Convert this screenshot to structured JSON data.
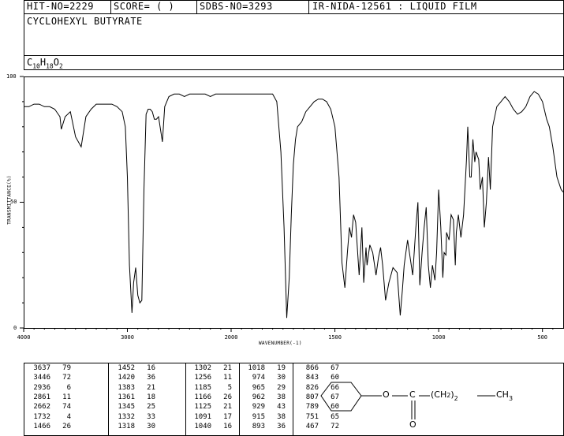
{
  "header": {
    "hit_no": "HIT-NO=2229",
    "score": "SCORE=  (  )",
    "sdbs_no": "SDBS-NO=3293",
    "ir_nida": "IR-NIDA-12561 : LIQUID FILM"
  },
  "compound_name": "CYCLOHEXYL BUTYRATE",
  "formula": {
    "c": "C",
    "c_n": "10",
    "h": "H",
    "h_n": "18",
    "o": "O",
    "o_n": "2"
  },
  "chart_data": {
    "type": "line",
    "xlabel": "WAVENUMBER(-1)",
    "ylabel": "TRANSMITTANCE(%)",
    "xlim": [
      4000,
      400
    ],
    "ylim": [
      0,
      100
    ],
    "x_ticks": [
      "4000",
      "3000",
      "2000",
      "1500",
      "1000",
      "500"
    ],
    "y_ticks": [
      "100",
      "50",
      "0"
    ],
    "series": [
      {
        "x": [
          4000,
          3950,
          3900,
          3850,
          3800,
          3750,
          3700,
          3650,
          3637,
          3600,
          3550,
          3500,
          3446,
          3400,
          3350,
          3300,
          3250,
          3200,
          3150,
          3100,
          3050,
          3020,
          3000,
          2980,
          2956,
          2940,
          2920,
          2900,
          2880,
          2861,
          2840,
          2820,
          2800,
          2780,
          2760,
          2740,
          2720,
          2700,
          2662,
          2640,
          2600,
          2550,
          2500,
          2450,
          2400,
          2350,
          2300,
          2250,
          2200,
          2150,
          2100,
          2050,
          2000,
          1950,
          1900,
          1850,
          1800,
          1780,
          1760,
          1745,
          1732,
          1720,
          1710,
          1700,
          1690,
          1680,
          1670,
          1660,
          1650,
          1640,
          1620,
          1600,
          1580,
          1560,
          1540,
          1520,
          1500,
          1480,
          1466,
          1452,
          1440,
          1430,
          1420,
          1410,
          1400,
          1383,
          1370,
          1361,
          1350,
          1345,
          1332,
          1318,
          1302,
          1290,
          1280,
          1270,
          1256,
          1240,
          1220,
          1200,
          1185,
          1175,
          1166,
          1150,
          1125,
          1110,
          1100,
          1091,
          1080,
          1070,
          1060,
          1050,
          1040,
          1030,
          1018,
          1010,
          1000,
          990,
          980,
          974,
          965,
          962,
          950,
          940,
          929,
          920,
          915,
          905,
          893,
          880,
          866,
          860,
          850,
          843,
          835,
          826,
          820,
          807,
          800,
          789,
          780,
          770,
          760,
          751,
          740,
          720,
          700,
          680,
          660,
          640,
          620,
          600,
          580,
          560,
          540,
          520,
          500,
          480,
          467,
          450,
          430,
          410,
          400
        ],
        "y": [
          88,
          88,
          89,
          89,
          88,
          88,
          87,
          84,
          79,
          84,
          86,
          76,
          72,
          84,
          87,
          89,
          89,
          89,
          89,
          88,
          86,
          80,
          60,
          25,
          6,
          18,
          24,
          13,
          10,
          11,
          55,
          85,
          87,
          87,
          86,
          83,
          83,
          84,
          74,
          88,
          92,
          93,
          93,
          92,
          93,
          93,
          93,
          93,
          92,
          93,
          93,
          93,
          93,
          93,
          93,
          93,
          93,
          90,
          70,
          40,
          4,
          20,
          45,
          65,
          75,
          80,
          81,
          82,
          84,
          86,
          88,
          90,
          91,
          91,
          90,
          87,
          80,
          60,
          26,
          16,
          30,
          40,
          36,
          45,
          42,
          21,
          40,
          18,
          32,
          25,
          33,
          30,
          21,
          28,
          32,
          25,
          11,
          18,
          24,
          22,
          5,
          15,
          25,
          35,
          21,
          40,
          50,
          17,
          30,
          40,
          48,
          25,
          16,
          25,
          19,
          30,
          55,
          40,
          20,
          30,
          29,
          38,
          35,
          45,
          43,
          25,
          38,
          45,
          36,
          45,
          67,
          80,
          60,
          60,
          75,
          66,
          70,
          67,
          55,
          60,
          40,
          50,
          68,
          55,
          80,
          88,
          90,
          92,
          90,
          87,
          85,
          86,
          88,
          92,
          94,
          93,
          90,
          83,
          80,
          72,
          60,
          55,
          54
        ]
      }
    ]
  },
  "peak_table": {
    "col1": [
      [
        "3637",
        "79"
      ],
      [
        "3446",
        "72"
      ],
      [
        "2936",
        "6"
      ],
      [
        "2861",
        "11"
      ],
      [
        "2662",
        "74"
      ],
      [
        "1732",
        "4"
      ],
      [
        "1466",
        "26"
      ]
    ],
    "col2": [
      [
        "1452",
        "16"
      ],
      [
        "1420",
        "36"
      ],
      [
        "1383",
        "21"
      ],
      [
        "1361",
        "18"
      ],
      [
        "1345",
        "25"
      ],
      [
        "1332",
        "33"
      ],
      [
        "1318",
        "30"
      ]
    ],
    "col3": [
      [
        "1302",
        "21"
      ],
      [
        "1256",
        "11"
      ],
      [
        "1185",
        "5"
      ],
      [
        "1166",
        "26"
      ],
      [
        "1125",
        "21"
      ],
      [
        "1091",
        "17"
      ],
      [
        "1040",
        "16"
      ]
    ],
    "col4": [
      [
        "1018",
        "19"
      ],
      [
        "974",
        "30"
      ],
      [
        "965",
        "29"
      ],
      [
        "962",
        "38"
      ],
      [
        "929",
        "43"
      ],
      [
        "915",
        "38"
      ],
      [
        "893",
        "36"
      ]
    ],
    "col5": [
      [
        "866",
        "67"
      ],
      [
        "843",
        "60"
      ],
      [
        "826",
        "66"
      ],
      [
        "807",
        "67"
      ],
      [
        "789",
        "60"
      ],
      [
        "751",
        "65"
      ],
      [
        "467",
        "72"
      ]
    ]
  },
  "structure": {
    "o_ester": "O",
    "c_carbonyl": "C",
    "ch2_left": "(CH",
    "ch2_sub": "2",
    "ch2_right": ")",
    "ch2_count": "2",
    "ch3": "CH",
    "ch3_sub": "3",
    "o_carbonyl": "O"
  }
}
